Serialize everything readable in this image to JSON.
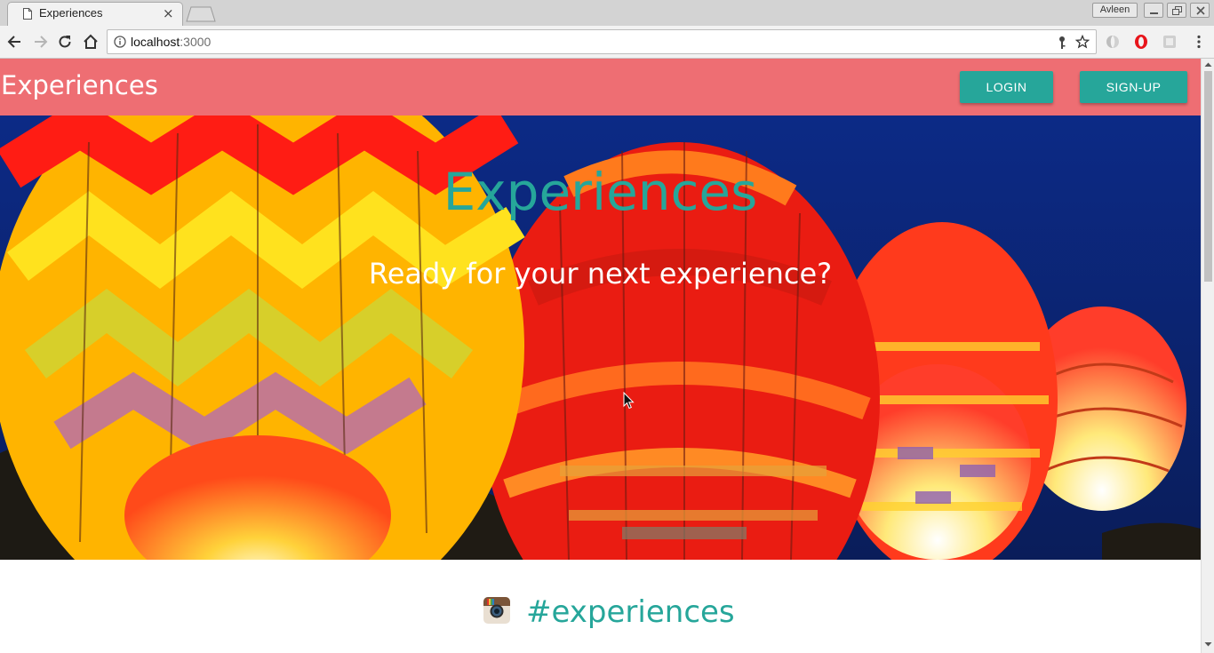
{
  "browser": {
    "tab_title": "Experiences",
    "tab_close": "×",
    "profile_name": "Avleen",
    "url_host": "localhost",
    "url_port": ":3000"
  },
  "navbar": {
    "brand": "Experiences",
    "login_label": "LOGIN",
    "signup_label": "SIGN-UP"
  },
  "hero": {
    "title": "Experiences",
    "tagline": "Ready for your next experience?"
  },
  "feed": {
    "hashtag": "#experiences"
  },
  "icons": {
    "tab": "document-icon",
    "nav": [
      "back-arrow-icon",
      "forward-arrow-icon",
      "reload-icon",
      "home-icon"
    ],
    "omnibox": [
      "info-icon",
      "key-icon",
      "star-icon"
    ],
    "extensions": [
      "extension-icon",
      "opera-icon",
      "extension-icon",
      "menu-dots-icon"
    ],
    "feed": "instagram-icon"
  },
  "colors": {
    "navbar": "#ee6e73",
    "accent": "#26a69a",
    "hero_sky": "#0c2470"
  }
}
